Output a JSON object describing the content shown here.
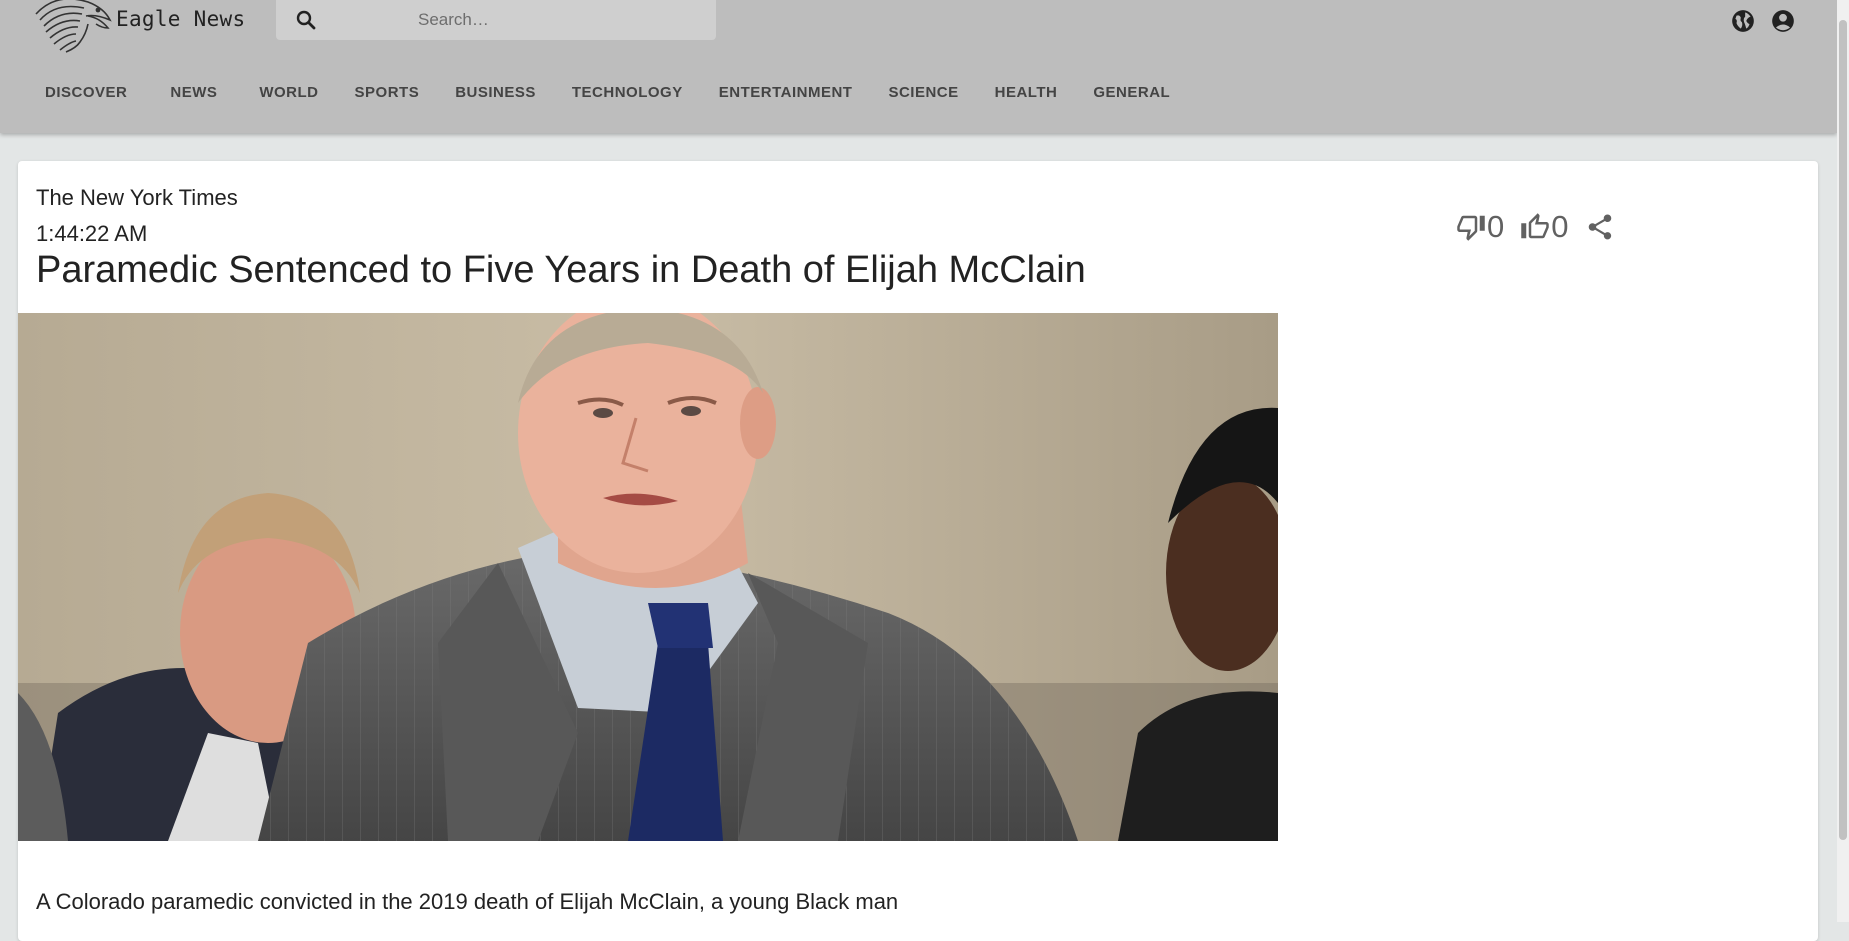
{
  "app": {
    "brand": "Eagle News"
  },
  "search": {
    "placeholder": "Search…"
  },
  "header": {
    "icons": [
      "globe-icon",
      "account-circle-icon"
    ]
  },
  "nav": {
    "items": [
      "DISCOVER",
      "NEWS",
      "WORLD",
      "SPORTS",
      "BUSINESS",
      "TECHNOLOGY",
      "ENTERTAINMENT",
      "SCIENCE",
      "HEALTH",
      "GENERAL"
    ]
  },
  "article": {
    "source": "The New York Times",
    "time": "1:44:22 AM",
    "headline": "Paramedic Sentenced to Five Years in Death of Elijah McClain",
    "dislikes": "0",
    "likes": "0",
    "summary": "A Colorado paramedic convicted in the 2019 death of Elijah McClain, a young Black man"
  },
  "colors": {
    "appbar": "#bdbdbd",
    "page_bg": "#e3e6e6",
    "card_bg": "#ffffff",
    "icon_gray": "#616161"
  }
}
